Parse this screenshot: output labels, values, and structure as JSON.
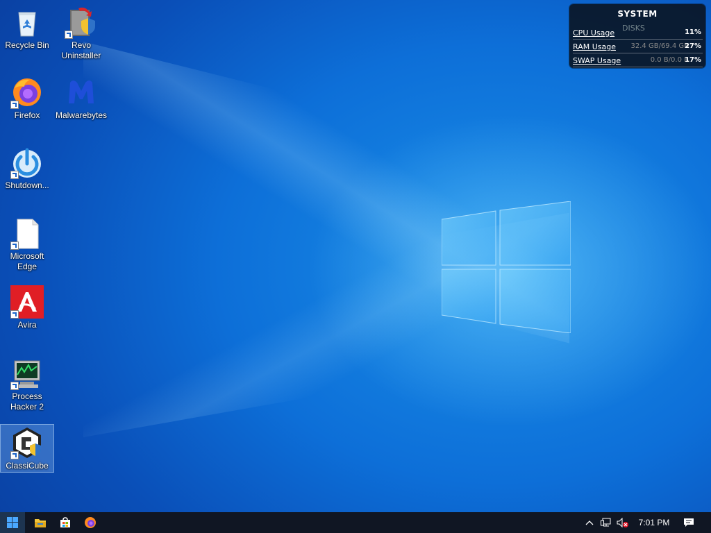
{
  "desktop": {
    "icons": [
      {
        "label": "Recycle Bin",
        "icon": "recycle-bin-icon"
      },
      {
        "label": "Revo Uninstaller",
        "icon": "revo-uninstaller-icon"
      },
      {
        "label": "Firefox",
        "icon": "firefox-icon"
      },
      {
        "label": "Malwarebytes",
        "icon": "malwarebytes-icon"
      },
      {
        "label": "Shutdown...",
        "icon": "shutdown-icon"
      },
      {
        "label": "Microsoft Edge",
        "icon": "blank-file-icon"
      },
      {
        "label": "Avira",
        "icon": "avira-icon"
      },
      {
        "label": "Process Hacker 2",
        "icon": "process-hacker-icon"
      },
      {
        "label": "ClassiCube",
        "icon": "classicube-icon"
      }
    ],
    "selected_icon": "ClassiCube"
  },
  "widget": {
    "title": "SYSTEM",
    "subtitle": "DISKS",
    "rows": [
      {
        "label": "CPU Usage",
        "mid": "",
        "value": "11%"
      },
      {
        "label": "RAM Usage",
        "mid": "32.4 GB/69.4 GB",
        "value": "27%"
      },
      {
        "label": "SWAP Usage",
        "mid": "0.0 B/0.0 B",
        "value": "17%"
      }
    ]
  },
  "taskbar": {
    "start_icon": "windows-start-icon",
    "pinned": [
      "file-explorer-icon",
      "microsoft-store-icon",
      "firefox-icon"
    ],
    "tray": [
      "chevron-up-icon",
      "network-icon",
      "volume-muted-icon"
    ],
    "clock": "7:01 PM",
    "notification_icon": "action-center-icon"
  },
  "colors": {
    "wallpaper": "#0d6fd8",
    "taskbar": "#101623",
    "avira_red": "#e01e25",
    "malwarebytes_blue": "#1e4ed8"
  }
}
